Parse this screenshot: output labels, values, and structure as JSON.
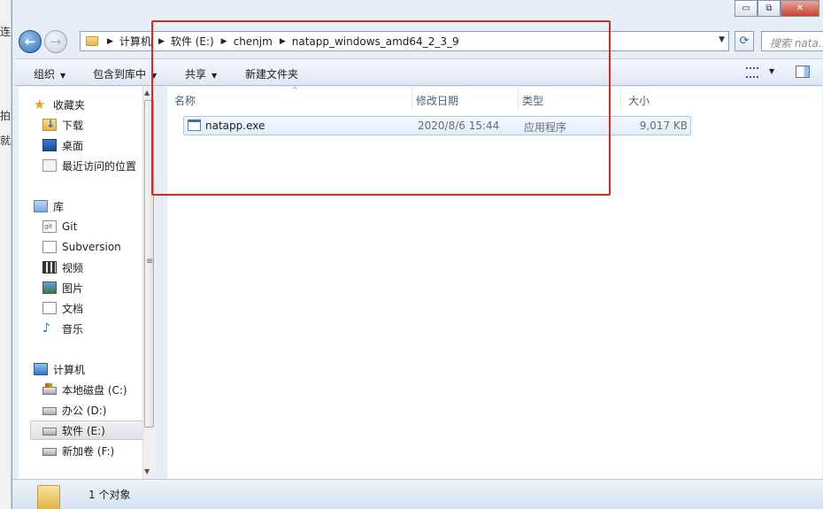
{
  "background_fragments": [
    "连",
    "拍",
    "就"
  ],
  "window_controls": {
    "minimize": "▭",
    "maximize": "⧉",
    "close": "✕"
  },
  "nav": {
    "back_glyph": "←",
    "forward_glyph": "→",
    "breadcrumb": [
      "计算机",
      "软件 (E:)",
      "chenjm",
      "natapp_windows_amd64_2_3_9"
    ],
    "crumb_separator": "▶",
    "dropdown_glyph": "▼",
    "refresh_glyph": "⟳",
    "search_placeholder": "搜索 nata..."
  },
  "toolbar": {
    "organize": "组织",
    "include_in_library": "包含到库中",
    "share": "共享",
    "new_folder": "新建文件夹",
    "caret": "▼"
  },
  "sidebar": {
    "favorites": {
      "label": "收藏夹",
      "items": [
        "下载",
        "桌面",
        "最近访问的位置"
      ]
    },
    "libraries": {
      "label": "库",
      "items": [
        "Git",
        "Subversion",
        "视频",
        "图片",
        "文档",
        "音乐"
      ]
    },
    "computer": {
      "label": "计算机",
      "items": [
        "本地磁盘 (C:)",
        "办公 (D:)",
        "软件 (E:)",
        "新加卷 (F:)"
      ],
      "selected": "软件 (E:)"
    },
    "scroll_up": "▲",
    "scroll_down": "▼"
  },
  "columns": {
    "name": "名称",
    "modified": "修改日期",
    "type": "类型",
    "size": "大小",
    "sort_glyph": "^"
  },
  "files": [
    {
      "name": "natapp.exe",
      "modified": "2020/8/6 15:44",
      "type": "应用程序",
      "size": "9,017 KB"
    }
  ],
  "status": {
    "item_count": "1 个对象"
  },
  "colors": {
    "annotation_red": "#e0261b",
    "selection_blue": "#a8c6ec",
    "accent": "#2f6fb8"
  }
}
